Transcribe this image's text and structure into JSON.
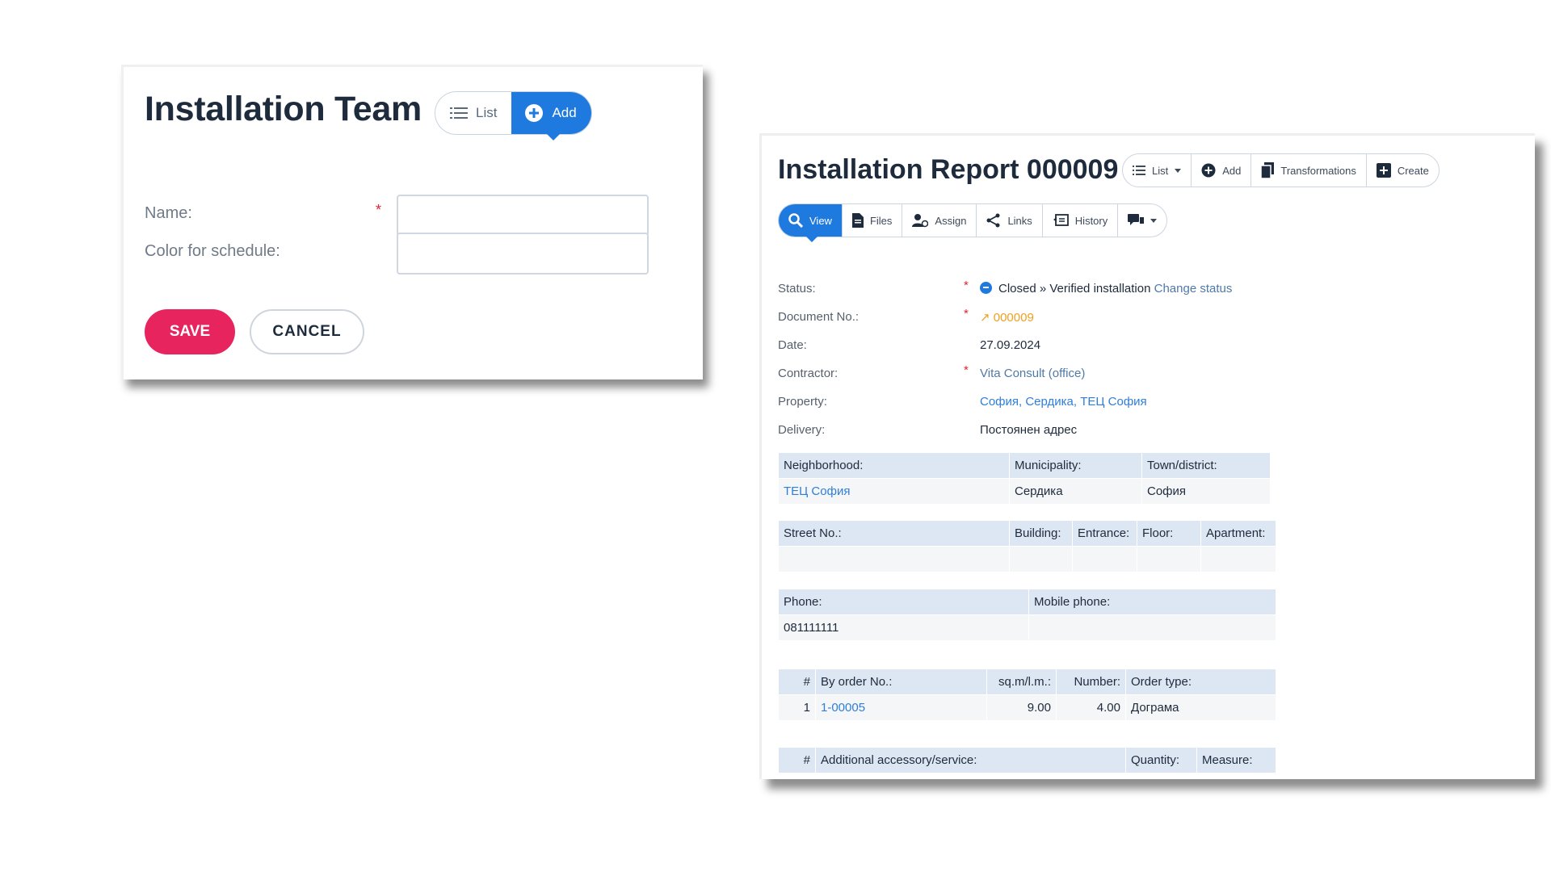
{
  "team": {
    "title": "Installation Team",
    "list_label": "List",
    "add_label": "Add",
    "name_label": "Name:",
    "required_mark": "*",
    "color_label": "Color for schedule:",
    "name_value": "",
    "color_value": "",
    "save_label": "SAVE",
    "cancel_label": "CANCEL"
  },
  "report": {
    "title": "Installation Report 000009",
    "top_toolbar": {
      "list": "List",
      "add": "Add",
      "transformations": "Transformations",
      "create": "Create"
    },
    "tabs": {
      "view": "View",
      "files": "Files",
      "assign": "Assign",
      "links": "Links",
      "history": "History"
    },
    "fields": {
      "status_label": "Status:",
      "status_value": "Closed » Verified installation",
      "change_status": "Change status",
      "docno_label": "Document No.:",
      "docno_value": "↗ 000009",
      "date_label": "Date:",
      "date_value": "27.09.2024",
      "contractor_label": "Contractor:",
      "contractor_value": "Vita Consult (office)",
      "property_label": "Property:",
      "property_value": "София, Сердика, ТЕЦ София",
      "delivery_label": "Delivery:",
      "delivery_value": "Постоянен адрес",
      "required_mark": "*"
    },
    "location_table": {
      "headers": [
        "Neighborhood:",
        "Municipality:",
        "Town/district:"
      ],
      "row": [
        "ТЕЦ София",
        "Сердика",
        "София"
      ]
    },
    "street_table": {
      "headers": [
        "Street No.:",
        "Building:",
        "Entrance:",
        "Floor:",
        "Apartment:"
      ],
      "row": [
        "",
        "",
        "",
        "",
        ""
      ]
    },
    "phone_table": {
      "headers": [
        "Phone:",
        "Mobile phone:"
      ],
      "row": [
        "081111111",
        ""
      ]
    },
    "order_table": {
      "headers": [
        "#",
        "By order No.:",
        "sq.m/l.m.:",
        "Number:",
        "Order type:"
      ],
      "rows": [
        [
          "1",
          "1-00005",
          "9.00",
          "4.00",
          "Дограма"
        ]
      ]
    },
    "accessory_table": {
      "headers": [
        "#",
        "Additional accessory/service:",
        "Quantity:",
        "Measure:"
      ]
    }
  },
  "colors": {
    "accent_blue": "#1f7ae0",
    "save_pink": "#e8245e",
    "required_red": "#e2232b",
    "link_blue": "#2f7ed8",
    "docno_orange": "#f0a020",
    "table_header": "#dde7f3"
  }
}
